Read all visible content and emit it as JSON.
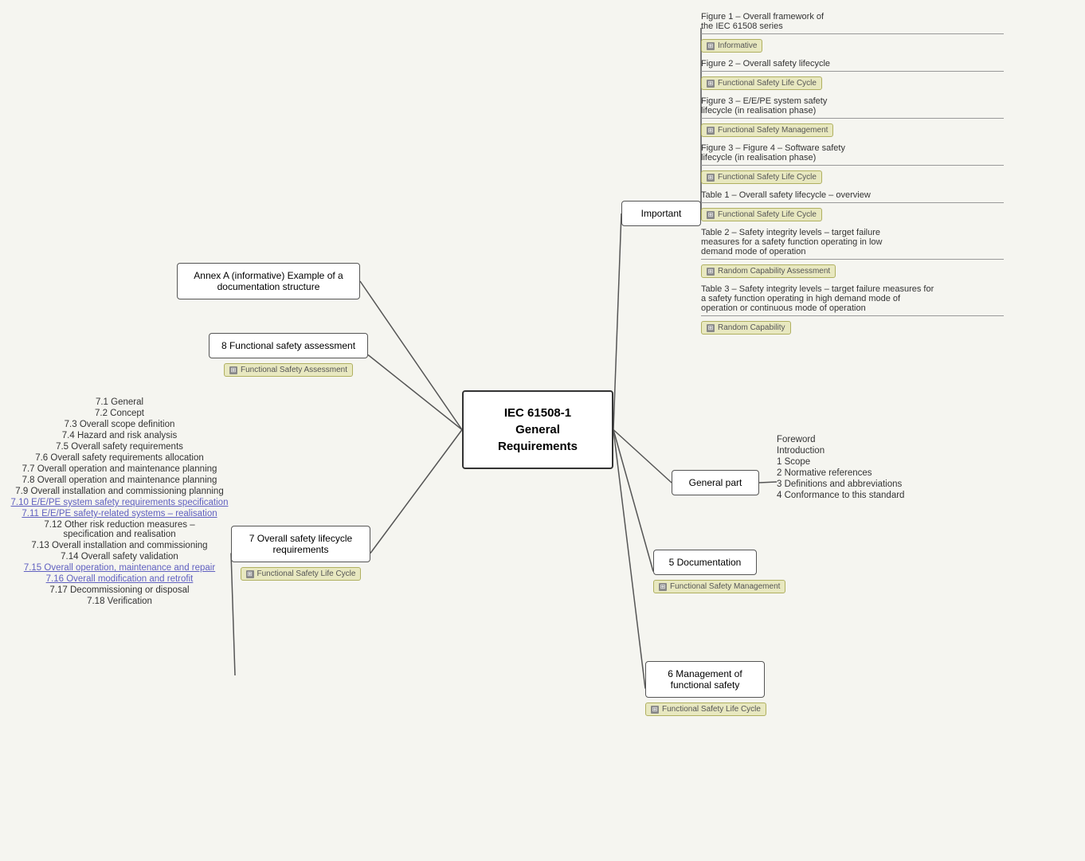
{
  "center": {
    "line1": "IEC 61508-1",
    "line2": "General",
    "line3": "Requirements"
  },
  "important_label": "Important",
  "general_part_label": "General part",
  "documentation_label": "5 Documentation",
  "management_label": "6 Management of\nfunctional safety",
  "overall_lifecycle_label": "7 Overall safety lifecycle\nrequirements",
  "functional_assessment_label": "8 Functional safety assessment",
  "annex_label": "Annex A (informative) Example of\na documentation structure",
  "tags": {
    "informative": "Informative",
    "fs_lifecycle": "Functional Safety Life Cycle",
    "fs_management": "Functional Safety Management",
    "random_capability_assessment": "Random Capability Assessment",
    "random_capability": "Random Capability",
    "fs_assessment": "Functional Safety Assessment",
    "fs_management2": "Functional Safety Management",
    "fs_lifecycle2": "Functional Safety Life Cycle",
    "fs_lifecycle3": "Functional Safety Life Cycle"
  },
  "figures": [
    {
      "label": "Figure 1 – Overall framework of\nthe IEC 61508 series",
      "tag": "Informative"
    },
    {
      "label": "Figure 2 – Overall safety lifecycle",
      "tag": "Functional Safety Life Cycle"
    },
    {
      "label": "Figure 3 – E/E/PE system safety\nlifecycle (in realisation phase)",
      "tag": "Functional Safety Management"
    },
    {
      "label": "Figure 3 – Figure 4 – Software safety\nlifecycle (in realisation phase)",
      "tag": "Functional Safety Life Cycle"
    },
    {
      "label": "Table 1 – Overall safety lifecycle – overview",
      "tag": "Functional Safety Life Cycle"
    },
    {
      "label": "Table 2 – Safety integrity levels – target failure\nmeasures for a safety function operating in low\ndemand mode of operation",
      "tag": "Random Capability Assessment"
    },
    {
      "label": "Table 3 – Safety integrity levels – target failure measures for\na safety function operating in high demand mode of\noperation or continuous mode of operation",
      "tag": "Random Capability"
    }
  ],
  "general_part_items": [
    "Foreword",
    "Introduction",
    "1 Scope",
    "2 Normative references",
    "3 Definitions and abbreviations",
    "4 Conformance to this standard"
  ],
  "section7_items": [
    "7.1 General",
    "7.2 Concept",
    "7.3 Overall scope definition",
    "7.4 Hazard and risk analysis",
    "7.5 Overall safety requirements",
    "7.6 Overall safety requirements allocation",
    "7.7 Overall operation and maintenance planning",
    "7.8 Overall operation and maintenance planning",
    "7.9 Overall installation and commissioning planning",
    "7.10 E/E/PE system safety requirements specification",
    "7.11 E/E/PE safety-related systems – realisation",
    "7.12 Other risk reduction measures –\nspecification and realisation",
    "7.13 Overall installation and commissioning",
    "7.14 Overall safety validation",
    "7.15 Overall operation, maintenance and repair",
    "7.16 Overall modification and retrofit",
    "7.17 Decommissioning or disposal",
    "7.18 Verification"
  ]
}
